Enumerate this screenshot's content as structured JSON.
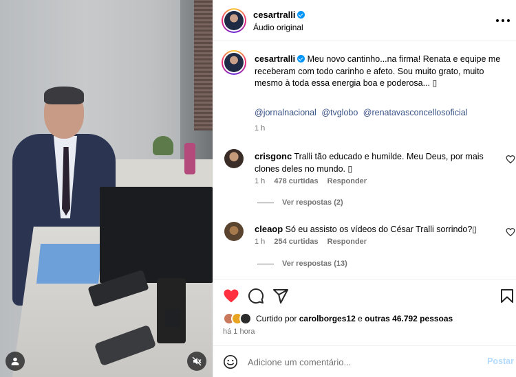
{
  "post": {
    "username": "cesartralli",
    "audio": "Áudio original",
    "caption": {
      "username": "cesartralli",
      "text": "Meu novo cantinho...na firma! Renata e equipe me receberam com todo carinho e afeto. Sou muito grato, muito mesmo à toda essa energia boa e poderosa... ▯",
      "mentions": [
        "@jornalnacional",
        "@tvglobo",
        "@renatavasconcellosoficial"
      ],
      "time": "1 h"
    },
    "comments": [
      {
        "username": "crisgonc",
        "text": "Tralli tão educado e humilde. Meu Deus, por mais clones deles no mundo. ▯",
        "time": "1 h",
        "likes": "478 curtidas",
        "reply_label": "Responder",
        "view_replies": "Ver respostas (2)"
      },
      {
        "username": "cleaop",
        "text": "Só eu assisto os vídeos do César Tralli sorrindo?▯",
        "time": "1 h",
        "likes": "254 curtidas",
        "reply_label": "Responder",
        "view_replies": "Ver respostas (13)"
      }
    ],
    "liked_by": {
      "prefix": "Curtido por",
      "user": "carolborges12",
      "middle": "e",
      "others": "outras 46.792 pessoas"
    },
    "posted_time": "há 1 hora",
    "add_comment": {
      "placeholder": "Adicione um comentário...",
      "post_label": "Postar"
    }
  },
  "colors": {
    "like_red": "#ff3040",
    "link_blue": "#385185",
    "verified_blue": "#0095f6",
    "muted_text": "#737373",
    "post_button_disabled": "#b3dbff"
  },
  "icons": [
    "verified-badge-icon",
    "more-options-icon",
    "heart-icon",
    "comment-icon",
    "share-icon",
    "bookmark-icon",
    "emoji-icon",
    "user-tag-icon",
    "muted-audio-icon"
  ]
}
